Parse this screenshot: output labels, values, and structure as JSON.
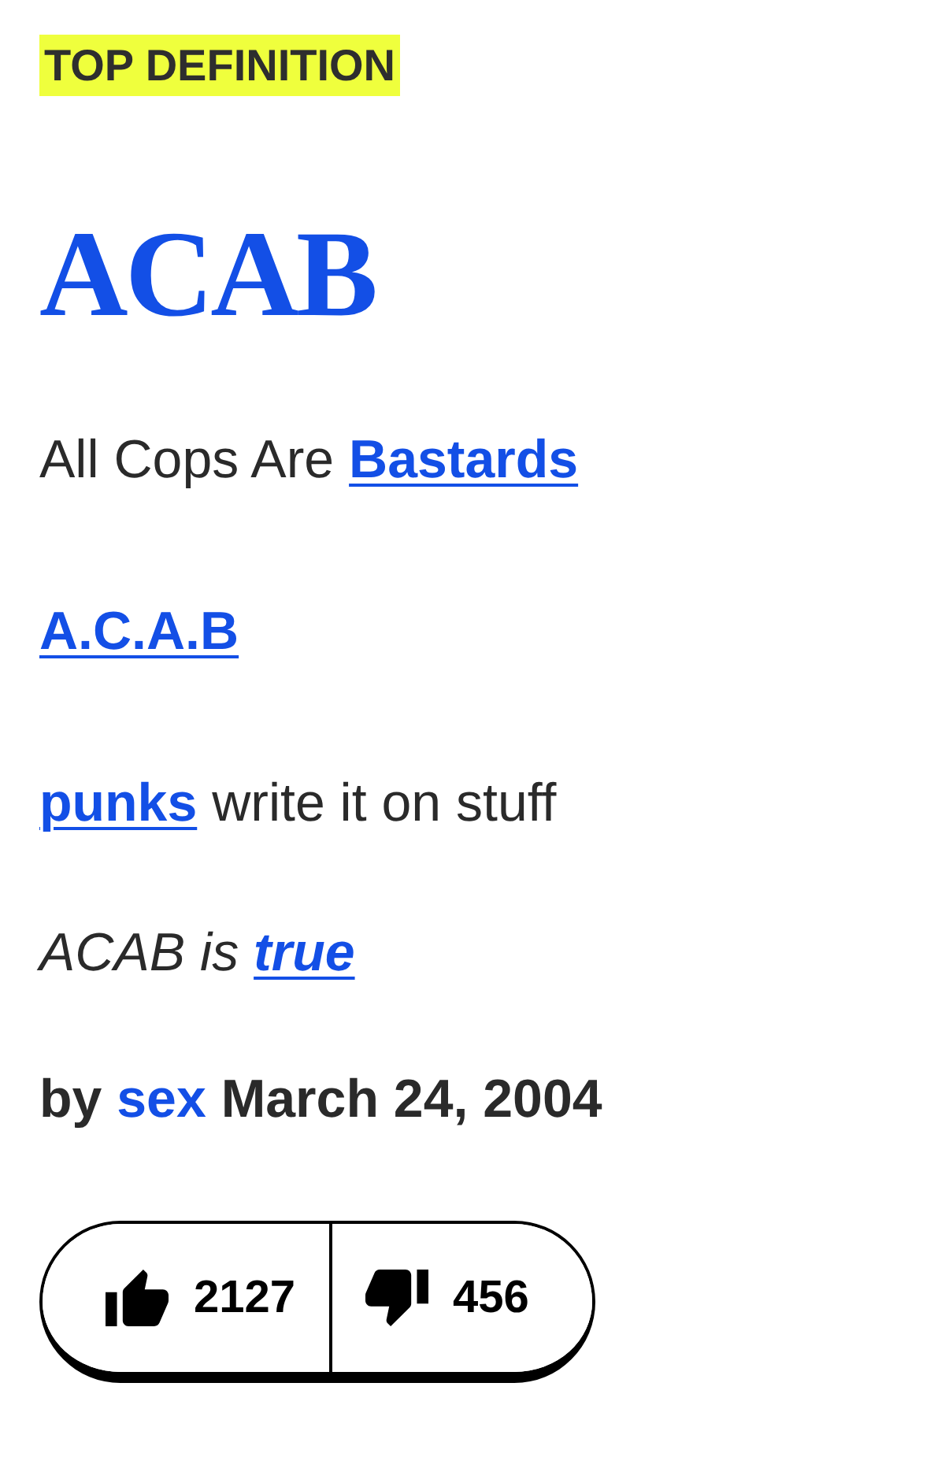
{
  "badge": {
    "label": "TOP DEFINITION"
  },
  "word": {
    "text": "ACAB"
  },
  "paragraphs": [
    {
      "kind": "meaning",
      "segments": [
        {
          "kind": "text",
          "text": "All Cops Are"
        },
        {
          "kind": "link",
          "text": "Bastards"
        }
      ]
    },
    {
      "kind": "meaning",
      "segments": [
        {
          "kind": "link",
          "text": "A.C.A.B"
        }
      ]
    },
    {
      "kind": "meaning",
      "segments": [
        {
          "kind": "link",
          "text": "punks"
        },
        {
          "kind": "text",
          "text": "write it on stuff"
        }
      ]
    },
    {
      "kind": "example",
      "segments": [
        {
          "kind": "text",
          "text": "ACAB is"
        },
        {
          "kind": "link",
          "text": "true"
        }
      ]
    }
  ],
  "byline": {
    "segments": [
      {
        "kind": "text",
        "text": "by"
      },
      {
        "kind": "author",
        "text": "sex"
      },
      {
        "kind": "text",
        "text": "March 24, 2004"
      }
    ]
  },
  "votes": [
    {
      "kind": "up",
      "count": "2127"
    },
    {
      "kind": "down",
      "count": "456"
    }
  ]
}
